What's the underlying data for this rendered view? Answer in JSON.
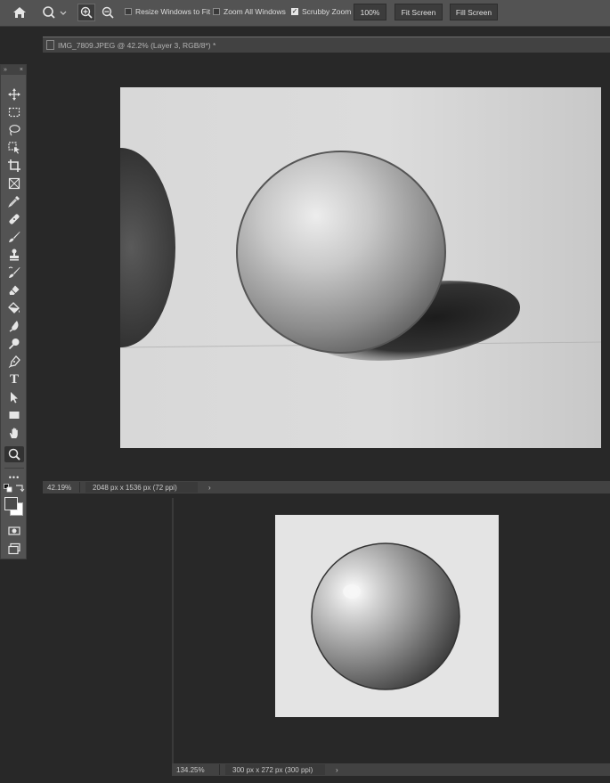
{
  "options_bar": {
    "resize_windows_label": "Resize Windows to Fit",
    "resize_windows_checked": false,
    "zoom_all_label": "Zoom All Windows",
    "zoom_all_checked": false,
    "scrubby_zoom_label": "Scrubby Zoom",
    "scrubby_zoom_checked": true,
    "percent_button": "100%",
    "fit_screen_button": "Fit Screen",
    "fill_screen_button": "Fill Screen"
  },
  "document_main": {
    "tab_title": "IMG_7809.JPEG @ 42.2% (Layer 3, RGB/8*) *",
    "zoom": "42.19%",
    "info": "2048 px x 1536 px (72 ppi)"
  },
  "document_second": {
    "zoom": "134.25%",
    "info": "300 px x 272 px (300 ppi)"
  },
  "toolbar": {
    "grip_left": "»",
    "grip_right": "×",
    "tools": [
      "move-tool",
      "marquee-tool",
      "lasso-tool",
      "object-select-tool",
      "crop-tool",
      "frame-tool",
      "eyedropper-tool",
      "healing-brush-tool",
      "brush-tool",
      "clone-stamp-tool",
      "history-brush-tool",
      "eraser-tool",
      "paint-bucket-tool",
      "blur-tool",
      "dodge-tool",
      "pen-tool",
      "type-tool",
      "path-select-tool",
      "rectangle-tool",
      "hand-tool",
      "zoom-tool",
      "edit-toolbar",
      "default-colors",
      "swap-colors",
      "foreground-color",
      "quick-mask",
      "screen-mode"
    ],
    "active_tool": "zoom-tool",
    "type_tool_glyph": "T",
    "more_glyph": "•••",
    "foreground_color": "#4a4a4a",
    "background_color": "#ffffff"
  },
  "status_arrow": "›"
}
